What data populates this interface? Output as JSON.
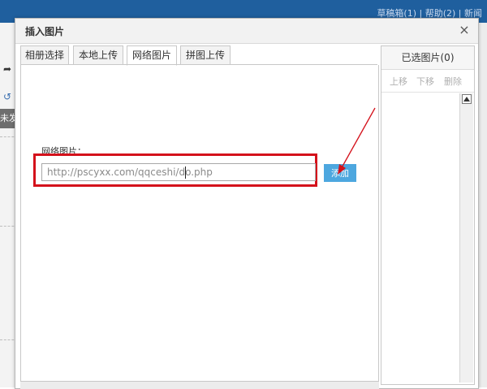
{
  "background": {
    "top_links": "草稿箱(1) | 帮助(2) | 新闻",
    "left_strip_text": "未发"
  },
  "dialog": {
    "title": "插入图片",
    "close_glyph": "×",
    "tabs": [
      {
        "label": "相册选择",
        "active": false
      },
      {
        "label": "本地上传",
        "active": false
      },
      {
        "label": "网络图片",
        "active": true
      },
      {
        "label": "拼图上传",
        "active": false
      }
    ],
    "field_label": "网络图片：",
    "url_value": "http://pscyxx.com/qqceshi/do.php",
    "add_button_label": "添加",
    "highlight_color": "#d4111b",
    "button_color": "#4da7df"
  },
  "selected_panel": {
    "title": "已选图片(0)",
    "actions": [
      "上移",
      "下移",
      "删除"
    ]
  }
}
